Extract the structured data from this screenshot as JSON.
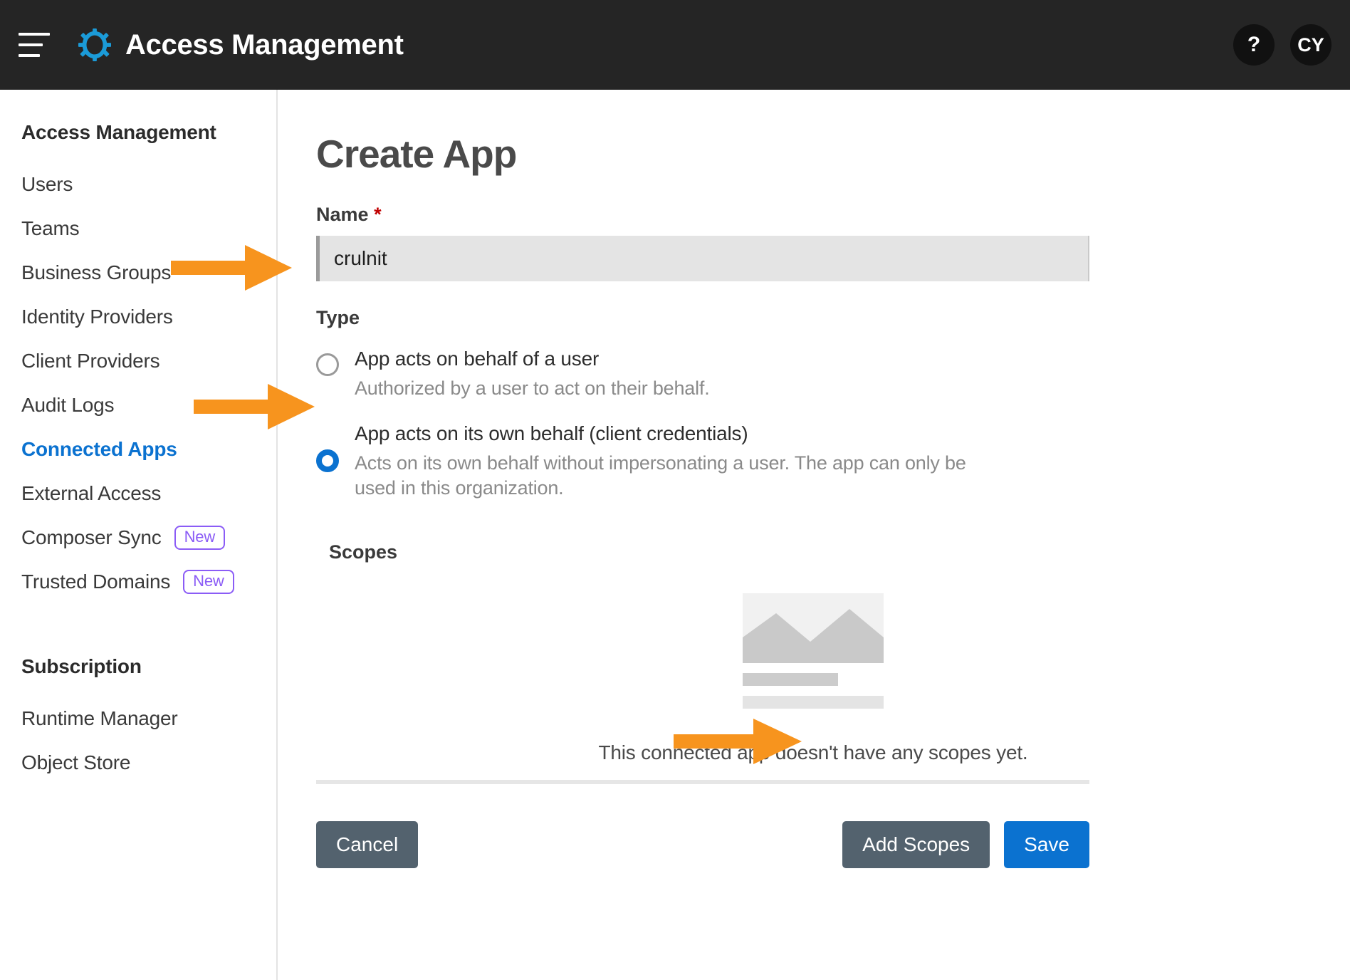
{
  "topbar": {
    "menu_icon": "hamburger-icon",
    "logo_icon": "gear-icon",
    "title": "Access Management",
    "help_label": "?",
    "avatar_initials": "CY"
  },
  "sidebar": {
    "sections": [
      {
        "heading": "Access Management",
        "items": [
          {
            "label": "Users",
            "active": false,
            "badge": null
          },
          {
            "label": "Teams",
            "active": false,
            "badge": null
          },
          {
            "label": "Business Groups",
            "active": false,
            "badge": null
          },
          {
            "label": "Identity Providers",
            "active": false,
            "badge": null
          },
          {
            "label": "Client Providers",
            "active": false,
            "badge": null
          },
          {
            "label": "Audit Logs",
            "active": false,
            "badge": null
          },
          {
            "label": "Connected Apps",
            "active": true,
            "badge": null
          },
          {
            "label": "External Access",
            "active": false,
            "badge": null
          },
          {
            "label": "Composer Sync",
            "active": false,
            "badge": "New"
          },
          {
            "label": "Trusted Domains",
            "active": false,
            "badge": "New"
          }
        ]
      },
      {
        "heading": "Subscription",
        "items": [
          {
            "label": "Runtime Manager",
            "active": false,
            "badge": null
          },
          {
            "label": "Object Store",
            "active": false,
            "badge": null
          }
        ]
      }
    ]
  },
  "main": {
    "page_title": "Create App",
    "name_field": {
      "label": "Name",
      "required_marker": "*",
      "value": "crulnit",
      "placeholder": ""
    },
    "type_section": {
      "label": "Type",
      "options": [
        {
          "title": "App acts on behalf of a user",
          "description": "Authorized by a user to act on their behalf.",
          "selected": false
        },
        {
          "title": "App acts on its own behalf (client credentials)",
          "description": "Acts on its own behalf without impersonating a user. The app can only be used in this organization.",
          "selected": true
        }
      ]
    },
    "scopes_section": {
      "label": "Scopes",
      "empty_message": "This connected app doesn't have any scopes yet.",
      "placeholder_icon": "broken-image-icon"
    },
    "footer": {
      "cancel_label": "Cancel",
      "add_scopes_label": "Add Scopes",
      "save_label": "Save"
    }
  },
  "annotations": {
    "arrow_color": "#F7941E",
    "arrows": [
      {
        "name": "arrow-to-business-groups",
        "target": "Business Groups"
      },
      {
        "name": "arrow-to-radio-client-credentials",
        "target": "App acts on its own behalf (client credentials)"
      },
      {
        "name": "arrow-to-add-scopes",
        "target": "Add Scopes"
      }
    ]
  },
  "colors": {
    "topbar_bg": "#252525",
    "accent_blue": "#0B72D0",
    "badge_purple": "#8B5CF6",
    "button_grey": "#53626E",
    "required_red": "#C00000"
  }
}
